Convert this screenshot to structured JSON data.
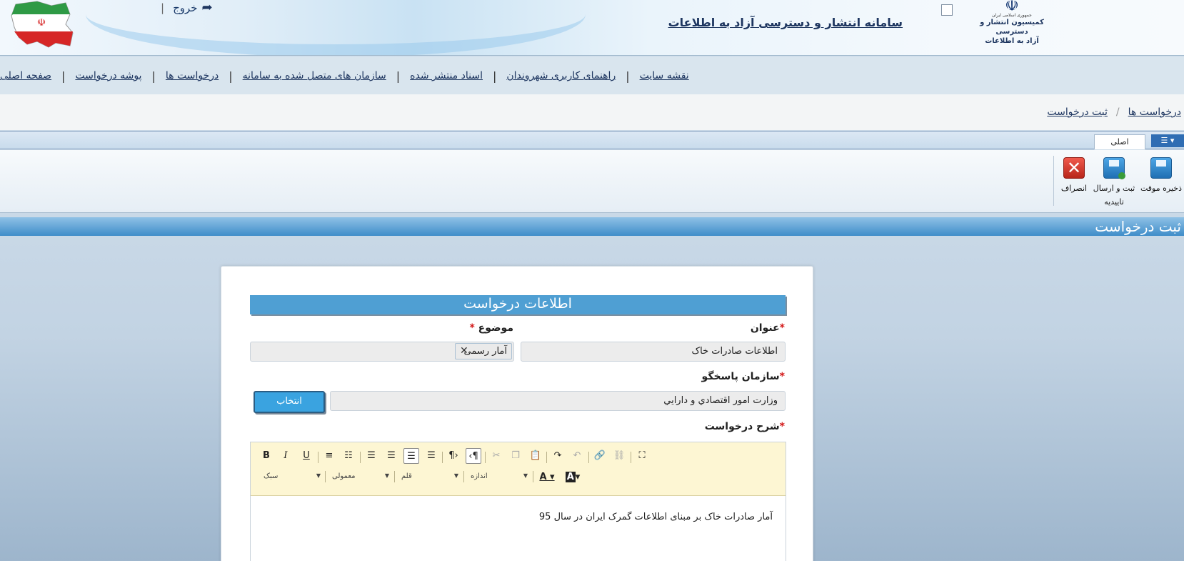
{
  "header": {
    "logout_label": "خروج",
    "site_title": "سامانه انتشار و دسترسی آزاد به اطلاعات",
    "emblem_line1": "جمهوری اسلامی ایران",
    "emblem_line2": "کمیسیون انتشار و دسترسی",
    "emblem_line3": "آزاد به اطلاعات"
  },
  "nav": {
    "items": [
      "صفحه اصلی",
      "پوشه درخواست",
      "درخواست ها",
      "سازمان های متصل شده به سامانه",
      "اسناد منتشر شده",
      "راهنمای کاربری شهروندان",
      "نقشه سایت"
    ]
  },
  "breadcrumb": {
    "items": [
      "درخواست ها",
      "ثبت درخواست"
    ]
  },
  "tabs": {
    "main_tab": "اصلی"
  },
  "ribbon": {
    "save_draft": "ذخیره موقت",
    "submit_line1": "ثبت و ارسال",
    "submit_line2": "تاییدیه",
    "cancel": "انصراف"
  },
  "section_title": "ثبت درخواست",
  "form": {
    "heading": "اطلاعات درخواست",
    "title_label": "عنوان",
    "title_value": "اطلاعات صادرات خاک",
    "subject_label": "موضوع",
    "subject_chip": "آمار رسمی",
    "org_label": "سازمان پاسخگو",
    "org_value": "وزارت امور اقتصادي و دارايي",
    "select_button": "انتخاب",
    "description_label": "شرح درخواست",
    "required_mark": "*",
    "description_text": "آمار صادرات خاک بر مبنای اطلاعات گمرک ایران در سال 95"
  },
  "editor": {
    "style_combo": "سبک",
    "format_combo": "معمولی",
    "font_combo": "قلم",
    "size_combo": "اندازه"
  },
  "colors": {
    "accent": "#4f9fd3",
    "button": "#3aa3e0",
    "required": "#d31717",
    "toolbar_bg": "#fdf6d3"
  }
}
